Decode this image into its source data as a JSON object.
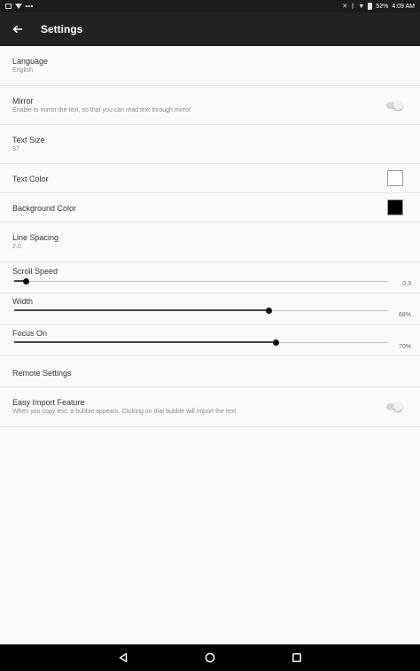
{
  "statusbar": {
    "battery": "52%",
    "time": "4:09 AM"
  },
  "appbar": {
    "title": "Settings"
  },
  "settings": {
    "language": {
      "title": "Language",
      "value": "English"
    },
    "mirror": {
      "title": "Mirror",
      "description": "Enable to mirror the text, so that you can read text through mirror",
      "enabled": false
    },
    "text_size": {
      "title": "Text Size",
      "value": "37"
    },
    "text_color": {
      "title": "Text Color",
      "color": "#ffffff"
    },
    "background_color": {
      "title": "Background Color",
      "color": "#000000"
    },
    "line_spacing": {
      "title": "Line Spacing",
      "value": "2.0"
    },
    "scroll_speed": {
      "title": "Scroll Speed",
      "value": "0.3",
      "fraction": 0.03
    },
    "width": {
      "title": "Width",
      "value": "68%",
      "fraction": 0.68
    },
    "focus_on": {
      "title": "Focus On",
      "value": "70%",
      "fraction": 0.7
    },
    "remote_settings": {
      "title": "Remote Settings"
    },
    "easy_import": {
      "title": "Easy Import Feature",
      "description": "When you copy text, a bubble appears. Clicking on that bubble will import the text",
      "enabled": false
    }
  },
  "icons": {
    "back": "arrow-left-icon",
    "nav_back": "triangle-back-icon",
    "nav_home": "circle-home-icon",
    "nav_recents": "square-recents-icon"
  }
}
